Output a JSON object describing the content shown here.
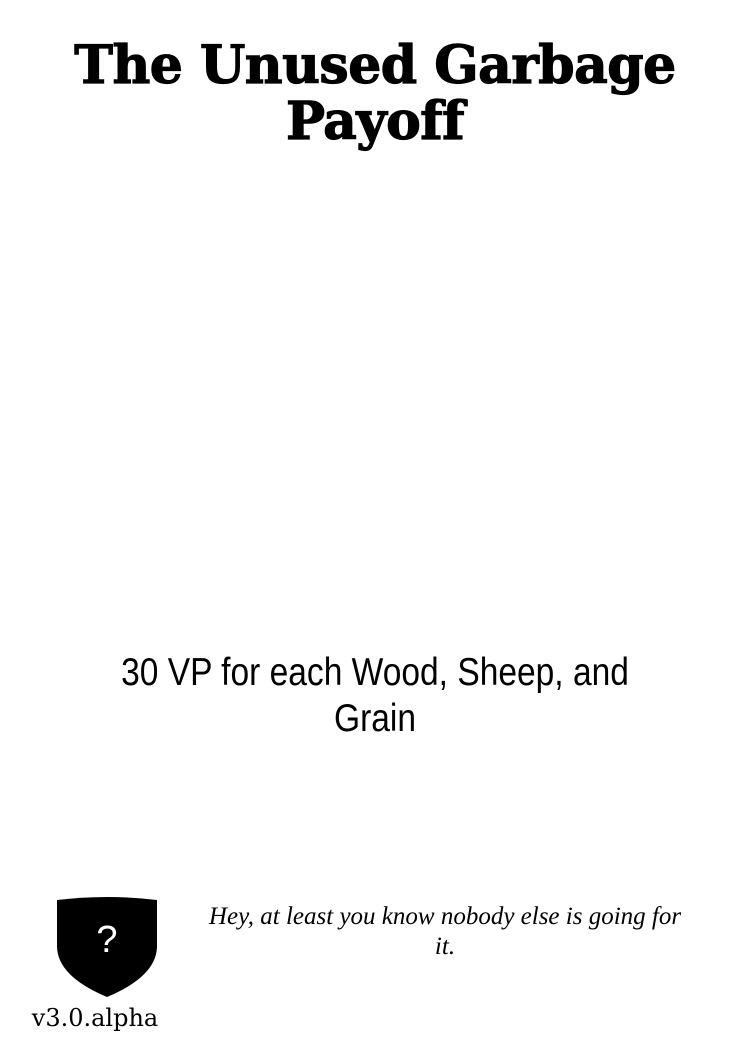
{
  "card": {
    "title": "The Unused Garbage Payoff",
    "effect": "30 VP for each Wood, Sheep, and Grain",
    "flavor": "Hey, at least you know nobody else is going for it.",
    "shield_mark": "?",
    "version": "v3.0.alpha"
  },
  "icons": {
    "shield": "shield-icon"
  },
  "colors": {
    "background": "#ffffff",
    "text": "#000000",
    "shield_fill": "#000000",
    "shield_mark": "#ffffff"
  }
}
